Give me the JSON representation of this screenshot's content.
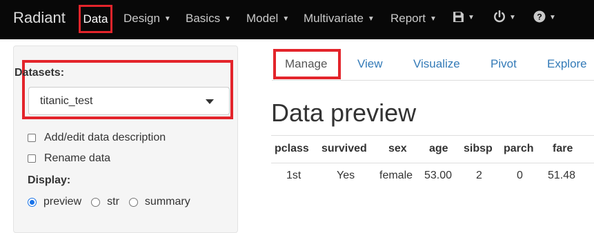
{
  "navbar": {
    "brand": "Radiant",
    "menus": [
      {
        "label": "Data"
      },
      {
        "label": "Design"
      },
      {
        "label": "Basics"
      },
      {
        "label": "Model"
      },
      {
        "label": "Multivariate"
      },
      {
        "label": "Report"
      }
    ],
    "icons": [
      "save-icon",
      "power-icon",
      "question-circle-icon"
    ],
    "caret": "▼"
  },
  "sidebar": {
    "datasets_label": "Datasets:",
    "dataset_selected": "titanic_test",
    "checkboxes": [
      {
        "label": "Add/edit data description",
        "checked": false
      },
      {
        "label": "Rename data",
        "checked": false
      }
    ],
    "display_label": "Display:",
    "display_options": [
      {
        "label": "preview",
        "selected": true
      },
      {
        "label": "str",
        "selected": false
      },
      {
        "label": "summary",
        "selected": false
      }
    ]
  },
  "tabs": [
    {
      "label": "Manage",
      "active": true
    },
    {
      "label": "View",
      "active": false
    },
    {
      "label": "Visualize",
      "active": false
    },
    {
      "label": "Pivot",
      "active": false
    },
    {
      "label": "Explore",
      "active": false
    }
  ],
  "main": {
    "title": "Data preview",
    "table": {
      "columns": [
        "pclass",
        "survived",
        "sex",
        "age",
        "sibsp",
        "parch",
        "fare"
      ],
      "rows": [
        [
          "1st",
          "Yes",
          "female",
          "53.00",
          "2",
          "0",
          "51.48"
        ]
      ]
    }
  },
  "colors": {
    "navbar_bg": "#080808",
    "highlight": "#e3242b",
    "link": "#337ab7",
    "radio_accent": "#1a73e8"
  }
}
